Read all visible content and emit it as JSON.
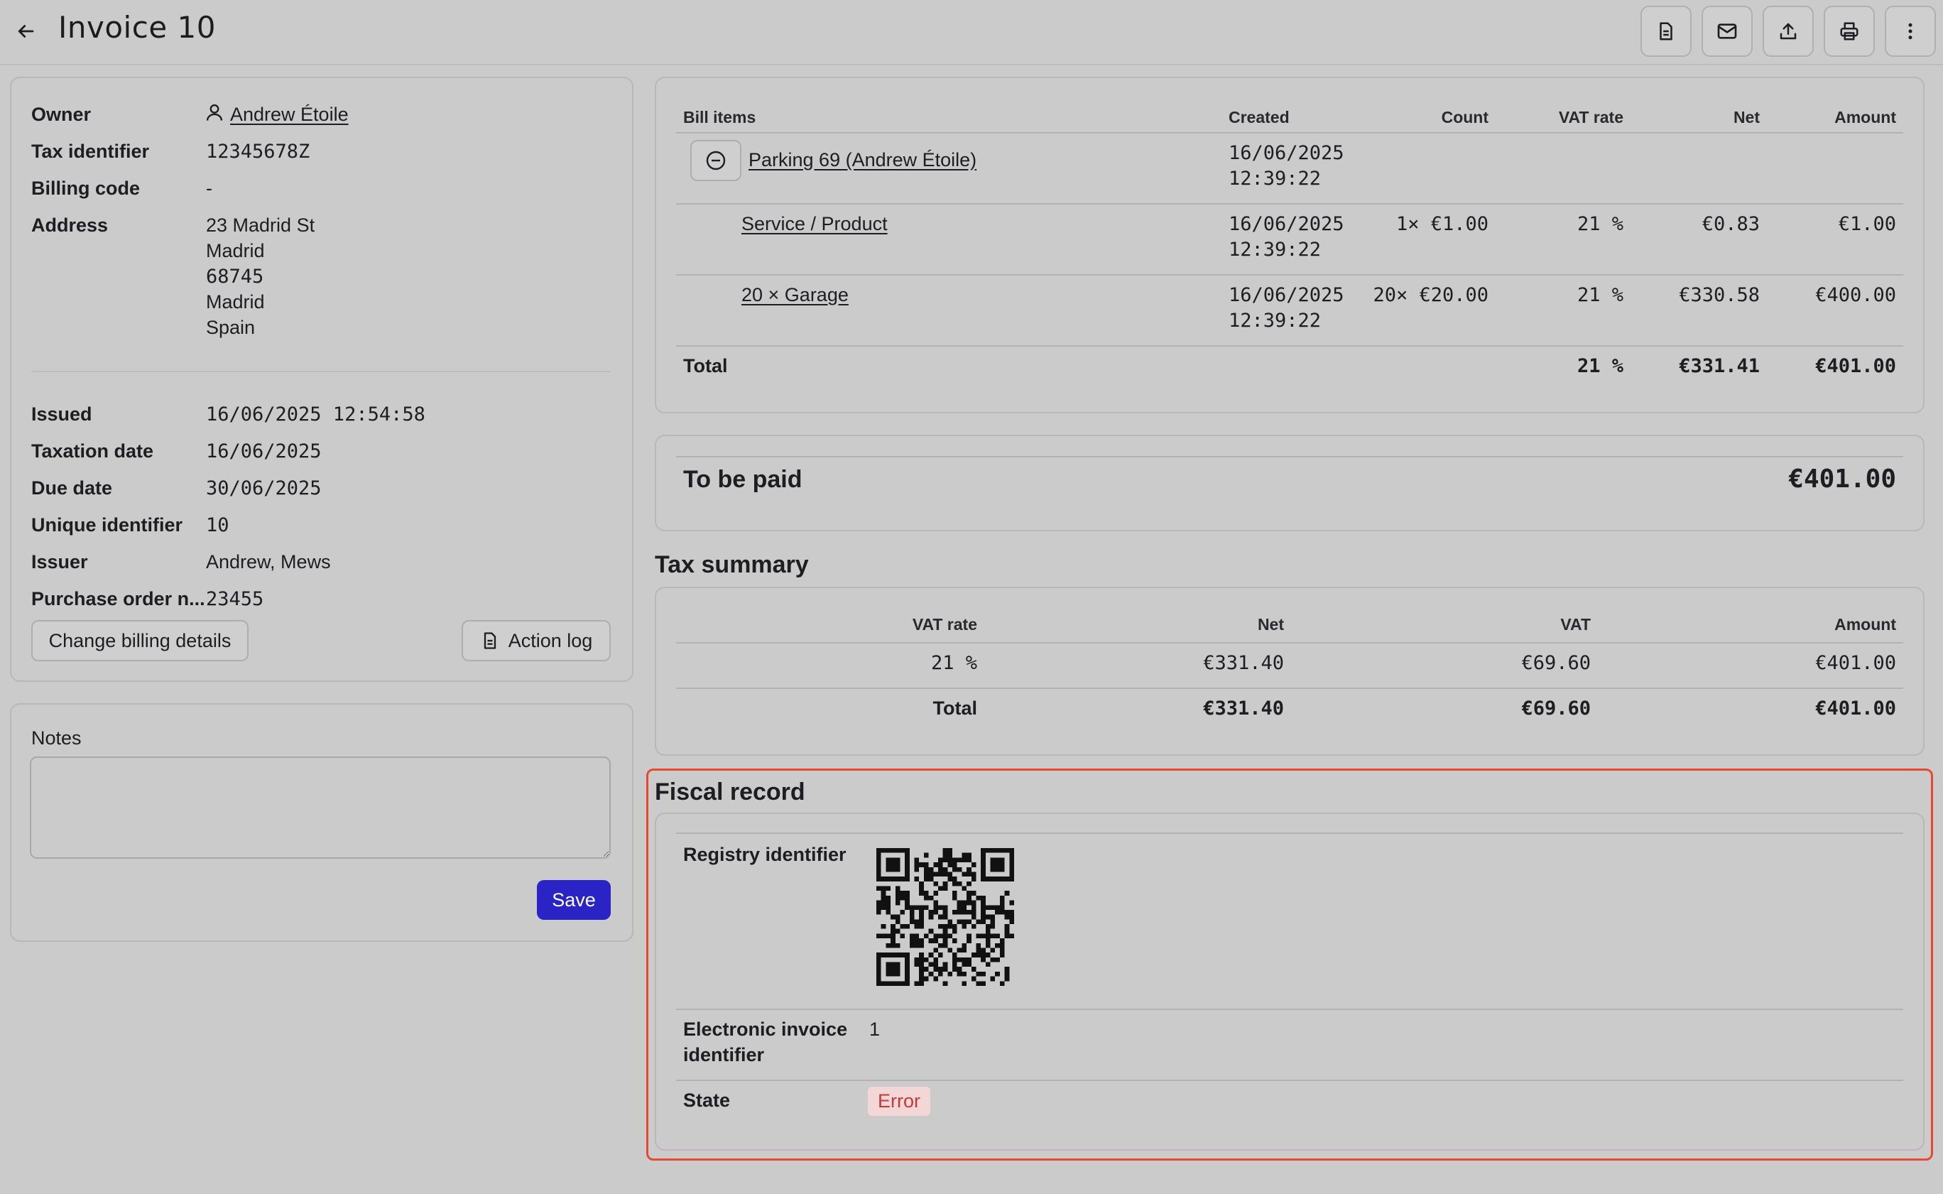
{
  "header": {
    "title": "Invoice 10",
    "icons": [
      "arrow-left-icon",
      "document-icon",
      "mail-icon",
      "upload-icon",
      "printer-icon",
      "more-vertical-icon"
    ]
  },
  "billing": {
    "owner_label": "Owner",
    "owner_value": "Andrew Étoile",
    "tax_id_label": "Tax identifier",
    "tax_id_value": "12345678Z",
    "billing_code_label": "Billing code",
    "billing_code_value": "-",
    "address_label": "Address",
    "address_lines": [
      "23 Madrid St",
      "Madrid",
      "68745",
      "Madrid",
      "Spain"
    ],
    "issued_label": "Issued",
    "issued_value": "16/06/2025 12:54:58",
    "taxation_date_label": "Taxation date",
    "taxation_date_value": "16/06/2025",
    "due_date_label": "Due date",
    "due_date_value": "30/06/2025",
    "unique_id_label": "Unique identifier",
    "unique_id_value": "10",
    "issuer_label": "Issuer",
    "issuer_value": "Andrew, Mews",
    "po_label": "Purchase order n...",
    "po_value": "23455",
    "change_billing_button": "Change billing details",
    "action_log_button": "Action log"
  },
  "notes": {
    "label": "Notes",
    "value": "",
    "save_button": "Save"
  },
  "bill_items": {
    "headers": [
      "Bill items",
      "Created",
      "Count",
      "VAT rate",
      "Net",
      "Amount"
    ],
    "parent": {
      "name": "Parking 69 (Andrew Étoile)",
      "created_date": "16/06/2025",
      "created_time": "12:39:22"
    },
    "rows": [
      {
        "name": "Service / Product",
        "created_date": "16/06/2025",
        "created_time": "12:39:22",
        "count": "1× €1.00",
        "vat": "21 %",
        "net": "€0.83",
        "amount": "€1.00"
      },
      {
        "name": "20 × Garage",
        "created_date": "16/06/2025",
        "created_time": "12:39:22",
        "count": "20× €20.00",
        "vat": "21 %",
        "net": "€330.58",
        "amount": "€400.00"
      }
    ],
    "total": {
      "label": "Total",
      "vat": "21 %",
      "net": "€331.41",
      "amount": "€401.00"
    }
  },
  "to_be_paid": {
    "label": "To be paid",
    "amount": "€401.00"
  },
  "tax_summary": {
    "title": "Tax summary",
    "headers": [
      "VAT rate",
      "Net",
      "VAT",
      "Amount"
    ],
    "row": {
      "vat_rate": "21 %",
      "net": "€331.40",
      "vat": "€69.60",
      "amount": "€401.00"
    },
    "total": {
      "label": "Total",
      "net": "€331.40",
      "vat": "€69.60",
      "amount": "€401.00"
    }
  },
  "fiscal_record": {
    "title": "Fiscal record",
    "registry_label": "Registry identifier",
    "einvoice_label_1": "Electronic invoice",
    "einvoice_label_2": "identifier",
    "einvoice_value": "1",
    "state_label": "State",
    "state_value": "Error"
  },
  "colors": {
    "background": "#cbcbcb",
    "primary_button": "#2a24c7",
    "highlight_border": "#e64a2e",
    "error_badge_bg": "#f3d6d6",
    "error_badge_text": "#c43a3a"
  }
}
